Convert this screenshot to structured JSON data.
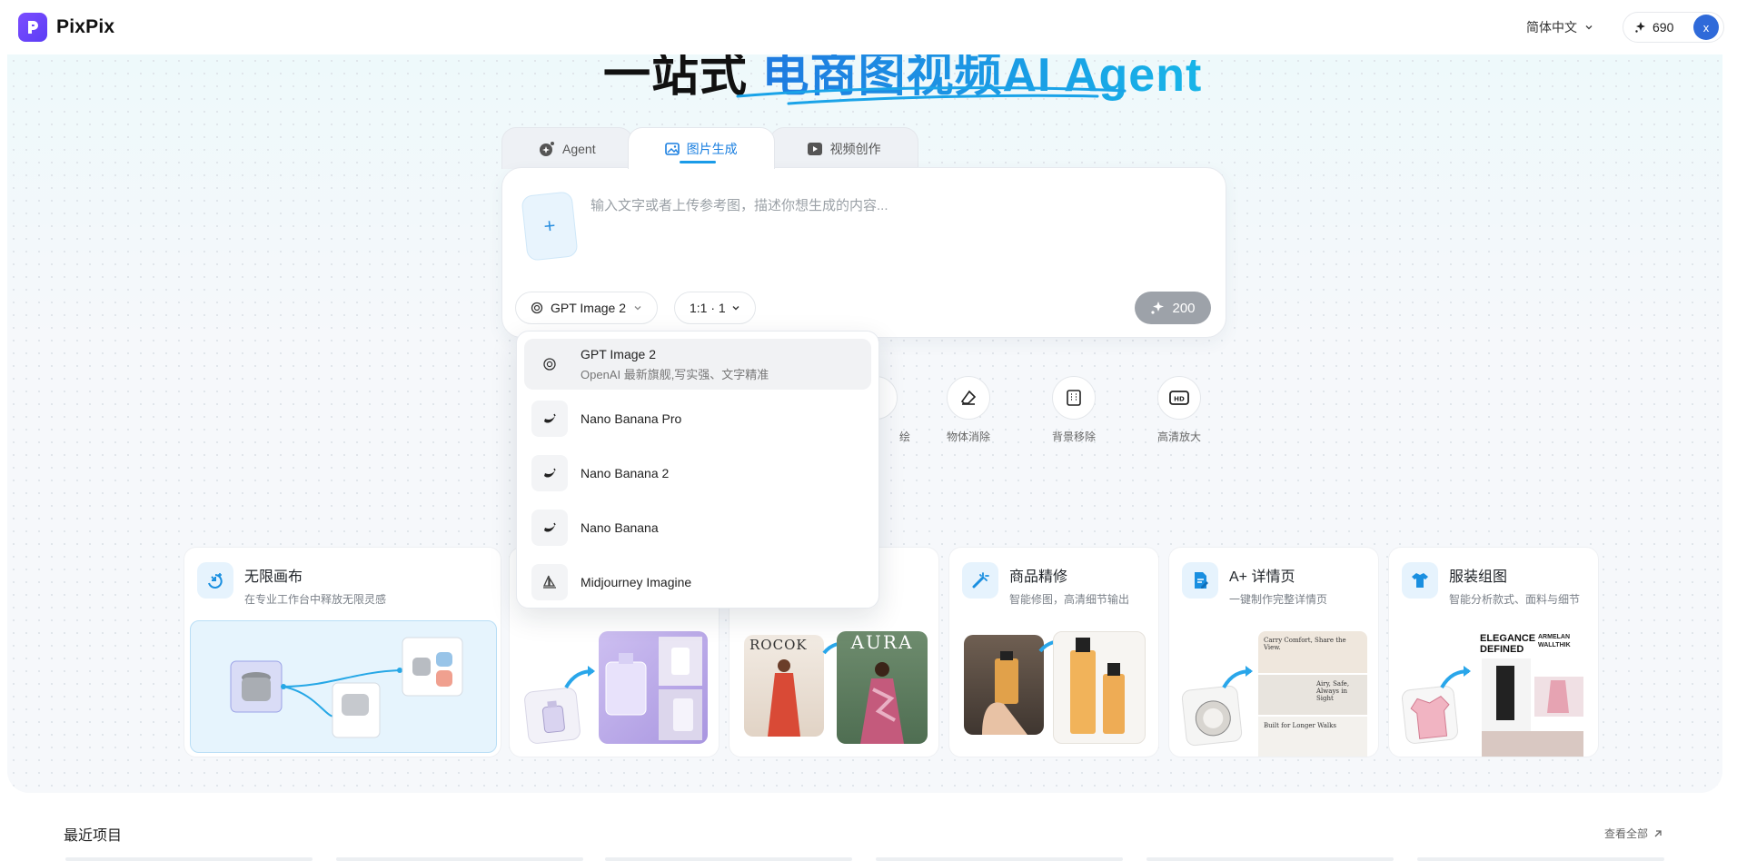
{
  "header": {
    "brand": "PixPix",
    "language": "简体中文",
    "credits": "690",
    "avatar_initial": "x"
  },
  "hero": {
    "title_dark": "一站式 ",
    "title_blue": "电商图视频AI Agent"
  },
  "tabs": [
    {
      "label": "Agent",
      "icon": "sparkle-agent-icon",
      "active": false
    },
    {
      "label": "图片生成",
      "icon": "image-icon",
      "active": true
    },
    {
      "label": "视频创作",
      "icon": "video-play-icon",
      "active": false
    }
  ],
  "prompt": {
    "placeholder": "输入文字或者上传参考图，描述你想生成的内容...",
    "model": "GPT Image 2",
    "ratio": "1:1 · 1",
    "cost": "200"
  },
  "dropdown": {
    "items": [
      {
        "name": "GPT Image 2",
        "desc": "OpenAI 最新旗舰,写实强、文字精准",
        "selected": true,
        "icon": "openai-icon"
      },
      {
        "name": "Nano Banana Pro",
        "desc": "",
        "selected": false,
        "icon": "banana-icon"
      },
      {
        "name": "Nano Banana 2",
        "desc": "",
        "selected": false,
        "icon": "banana-icon"
      },
      {
        "name": "Nano Banana",
        "desc": "",
        "selected": false,
        "icon": "banana-icon"
      },
      {
        "name": "Midjourney Imagine",
        "desc": "",
        "selected": false,
        "icon": "sailboat-icon"
      }
    ]
  },
  "tools": [
    {
      "label": "绘",
      "icon": "partial-icon"
    },
    {
      "label": "物体消除",
      "icon": "eraser-icon"
    },
    {
      "label": "背景移除",
      "icon": "background-remove-icon"
    },
    {
      "label": "高清放大",
      "icon": "hd-icon"
    }
  ],
  "cards": [
    {
      "title": "无限画布",
      "subtitle": "在专业工作台中释放无限灵感",
      "icon": "canvas-icon"
    },
    {
      "title": "",
      "subtitle": "",
      "icon": ""
    },
    {
      "title": "",
      "subtitle": "",
      "icon": ""
    },
    {
      "title": "商品精修",
      "subtitle": "智能修图，高清细节输出",
      "icon": "magic-wand-icon"
    },
    {
      "title": "A+ 详情页",
      "subtitle": "一键制作完整详情页",
      "icon": "document-edit-icon"
    },
    {
      "title": "服装组图",
      "subtitle": "智能分析款式、面料与细节",
      "icon": "tshirt-icon"
    }
  ],
  "card_text": {
    "rocok": "ROCOK",
    "aura": "AURA",
    "aplus1": "Carry Comfort, Share the View.",
    "aplus2": "Airy, Safe, Always in Sight",
    "aplus3": "Built for Longer Walks",
    "elegance": "ELEGANCE DEFINED",
    "armelan": "ARMELAN WALLTHIK"
  },
  "recent": {
    "title": "最近项目",
    "view_all": "查看全部"
  }
}
